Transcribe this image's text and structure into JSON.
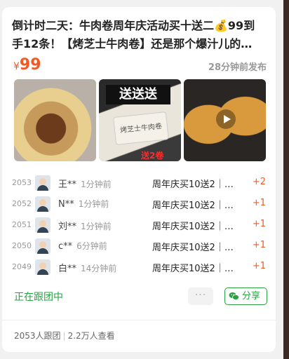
{
  "post": {
    "title_line1": "倒计时二天：牛肉卷周年庆活动买十送二💰99到",
    "title_line2": "手12条！【烤芝士牛肉卷】还是那个爆汁儿的…",
    "price_currency": "¥",
    "price_value": "99",
    "published": "28分钟前发布"
  },
  "images": [
    {
      "name": "beef-roll-cross-section-photo"
    },
    {
      "name": "promo-product-photo",
      "banner": "送送送",
      "product_text": "烤芝士牛肉卷",
      "promo": "送2卷"
    },
    {
      "name": "beef-roll-video-thumbnail",
      "icon": "play-icon"
    }
  ],
  "orders": [
    {
      "seq": "2053",
      "user": "王**",
      "time": "1分钟前",
      "item": "周年庆买10送2｜…",
      "qty": "+2"
    },
    {
      "seq": "2052",
      "user": "N**",
      "time": "1分钟前",
      "item": "周年庆买10送2｜…",
      "qty": "+1"
    },
    {
      "seq": "2051",
      "user": "刘**",
      "time": "1分钟前",
      "item": "周年庆买10送2｜…",
      "qty": "+1"
    },
    {
      "seq": "2050",
      "user": "c**",
      "time": "6分钟前",
      "item": "周年庆买10送2｜…",
      "qty": "+1"
    },
    {
      "seq": "2049",
      "user": "白**",
      "time": "14分钟前",
      "item": "周年庆买10送2｜…",
      "qty": "+1"
    }
  ],
  "actions": {
    "following_label": "正在跟团中",
    "more_label": "···",
    "share_label": "分享"
  },
  "stats": {
    "joined": "2053人跟团",
    "views": "2.2万人查看",
    "separator": "|"
  },
  "colors": {
    "accent_orange": "#f15a24",
    "accent_green": "#2aa243"
  }
}
